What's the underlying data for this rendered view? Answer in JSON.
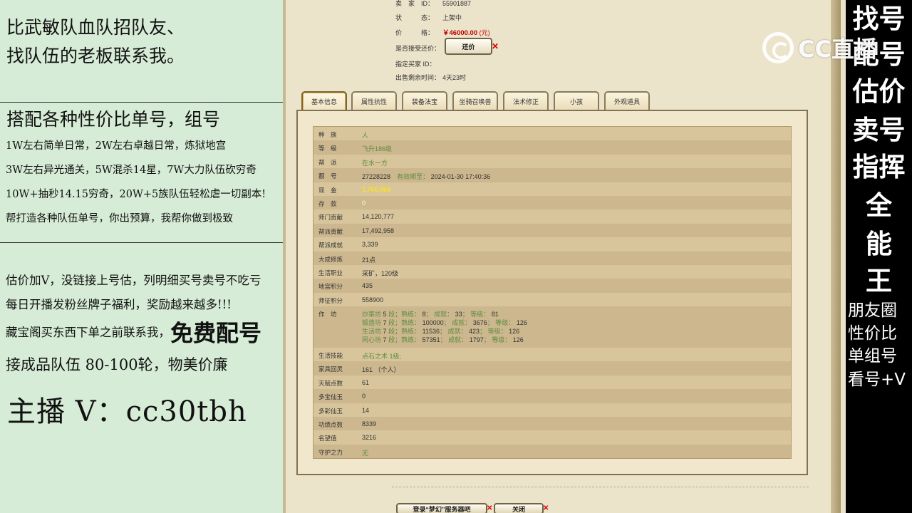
{
  "left_panel": {
    "headline_1": "比武敏队血队招队友、",
    "headline_2": "找队伍的老板联系我。",
    "section_title": "搭配各种性价比单号，组号",
    "lines": [
      "1W左右简单日常，2W左右卓越日常，炼狱地宫",
      "3W左右异光通关，5W混杀14星，7W大力队伍砍穷奇",
      "10W+抽秒14.15穷奇，20W+5族队伍轻松虐一切副本!",
      "帮打造各种队伍单号，你出预算，我帮你做到极致"
    ],
    "promo_1": "估价加V，没链接上号估，列明细买号卖号不吃亏",
    "promo_2": "每日开播发粉丝牌子福利，奖励越来越多!!!",
    "promo_3": "藏宝阁买东西下单之前联系我，",
    "free_match": "免费配号",
    "promo_4": "接成品队伍 80-100轮，物美价廉",
    "anchor_contact": "主播 V：cc30tbh"
  },
  "listing": {
    "seller_label": "卖　家　ID：",
    "seller_id": "55901887",
    "status_label": "状　　　态：",
    "status_value": "上架中",
    "price_label": "价　　　格：",
    "price_value": "￥46000.00",
    "price_unit": "(元)",
    "bargain_label": "是否接受还价：",
    "bargain_button": "还价",
    "buyer_label": "指定买家 ID：",
    "remaining_label": "出售剩余时间：",
    "remaining_value": "4天23时"
  },
  "tabs": [
    "基本信息",
    "属性抗性",
    "装备法宝",
    "坐骑召唤兽",
    "法术修正",
    "小孩",
    "外观道具"
  ],
  "rows": [
    {
      "k": "种　族",
      "v": "人"
    },
    {
      "k": "等　级",
      "v": "飞升186级"
    },
    {
      "k": "帮　派",
      "v": "在水一方"
    },
    {
      "k": "靓　号",
      "v": "27228228",
      "extra_label": "有效期至：",
      "extra_value": "2024-01-30 17:40:36"
    },
    {
      "k": "现　金",
      "v": "1,766,968"
    },
    {
      "k": "存　款",
      "v": "0"
    },
    {
      "k": "师门贡献",
      "v": "14,120,777"
    },
    {
      "k": "帮派贡献",
      "v": "17,492,958"
    },
    {
      "k": "帮派成就",
      "v": "3,339"
    },
    {
      "k": "大成修炼",
      "v": "21点"
    },
    {
      "k": "生活职业",
      "v": "采矿，120级"
    },
    {
      "k": "地宫积分",
      "v": "435"
    },
    {
      "k": "师征积分",
      "v": "558900"
    }
  ],
  "workshop": {
    "k": "作　坊",
    "lines": [
      {
        "name": "炒菜坊",
        "seg": "5",
        "skill": "8",
        "score": "33",
        "level": "81"
      },
      {
        "name": "锻造坊",
        "seg": "7",
        "skill": "100000",
        "score": "3676",
        "level": "126"
      },
      {
        "name": "生活坊",
        "seg": "7",
        "skill": "11536",
        "score": "423",
        "level": "126"
      },
      {
        "name": "同心坊",
        "seg": "7",
        "skill": "57351",
        "score": "1797",
        "level": "126"
      }
    ],
    "seg_label": "段；",
    "skill_label": "熟练：",
    "score_label": "成就：",
    "level_label": "等级：",
    "sep": "；"
  },
  "rows2": [
    {
      "k": "生活技能",
      "v": "点石之术 1级;"
    },
    {
      "k": "家具回灵",
      "v": "161 （个人）"
    },
    {
      "k": "天赋点数",
      "v": "61"
    },
    {
      "k": "多宝仙玉",
      "v": "0"
    },
    {
      "k": "多彩仙玉",
      "v": "14"
    },
    {
      "k": "功绩点数",
      "v": "8339"
    },
    {
      "k": "名望值",
      "v": "3216"
    },
    {
      "k": "守护之力",
      "v": "无"
    }
  ],
  "footer": {
    "login_button": "登录“梦幻”服务器吧",
    "close_button": "关闭"
  },
  "right_panel": {
    "big_lines": [
      "找号",
      "配号",
      "估价",
      "卖号",
      "指挥",
      "全",
      "能",
      "王"
    ],
    "small_lines": [
      "朋友圈",
      "性价比",
      "单组号",
      "看号+V"
    ]
  },
  "watermark": {
    "text": "CC直播"
  }
}
